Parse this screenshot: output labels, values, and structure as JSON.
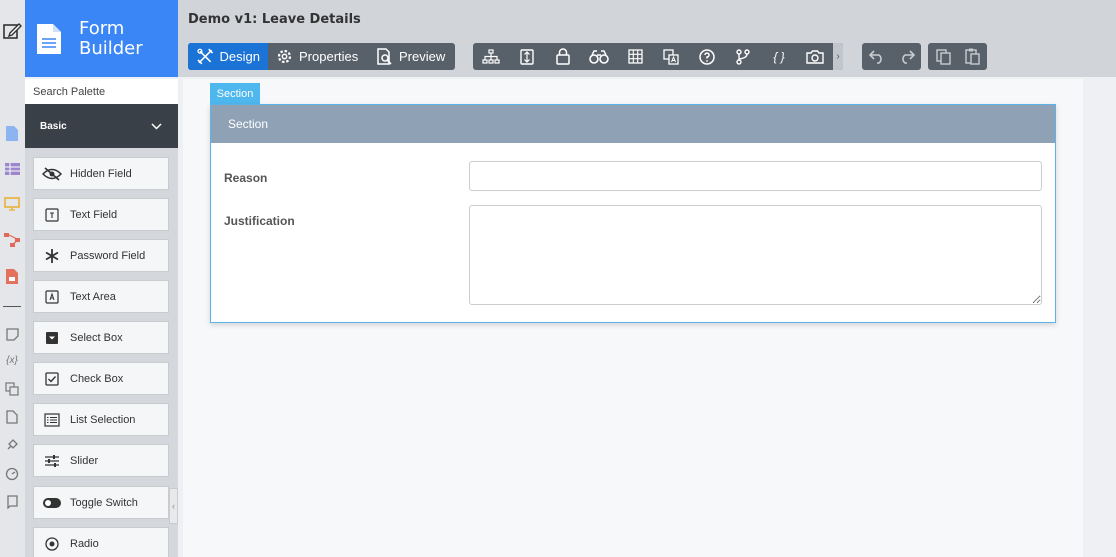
{
  "app": {
    "brand_line1": "Form",
    "brand_line2": "Builder",
    "form_title": "Demo v1: Leave Details"
  },
  "left_rail": {
    "icons": [
      "edit-icon",
      "document-icon",
      "table-icon",
      "monitor-icon",
      "flow-icon",
      "pdf-icon",
      "note-icon",
      "variable-icon",
      "translate-icon",
      "file-icon",
      "plugin-icon",
      "gauge-icon",
      "scroll-icon"
    ]
  },
  "palette": {
    "search_placeholder": "Search Palette",
    "category": "Basic",
    "items": [
      {
        "label": "Hidden Field",
        "icon": "eye-slash-icon"
      },
      {
        "label": "Text Field",
        "icon": "text-field-icon"
      },
      {
        "label": "Password Field",
        "icon": "asterisk-icon"
      },
      {
        "label": "Text Area",
        "icon": "text-area-icon"
      },
      {
        "label": "Select Box",
        "icon": "select-box-icon"
      },
      {
        "label": "Check Box",
        "icon": "checkbox-icon"
      },
      {
        "label": "List Selection",
        "icon": "list-icon"
      },
      {
        "label": "Slider",
        "icon": "sliders-icon"
      },
      {
        "label": "Toggle Switch",
        "icon": "toggle-icon"
      },
      {
        "label": "Radio",
        "icon": "radio-icon"
      }
    ]
  },
  "toolbar": {
    "design": "Design",
    "properties": "Properties",
    "preview": "Preview",
    "tools": [
      "hierarchy-icon",
      "database-icon",
      "lock-icon",
      "binoculars-icon",
      "grid-icon",
      "translate-icon",
      "help-icon",
      "branch-icon",
      "braces-icon",
      "camera-icon"
    ],
    "braces_glyph": "{ }"
  },
  "form": {
    "section_tab": "Section",
    "section_title": "Section",
    "fields": [
      {
        "label": "Reason",
        "value": ""
      },
      {
        "label": "Justification",
        "value": ""
      }
    ]
  },
  "colors": {
    "brand": "#3b86f7",
    "active_tab": "#1c73d6",
    "section_header": "#8fa2b5",
    "section_tab": "#4eb7ee",
    "toolbar": "#586069",
    "category_bar": "#394048"
  }
}
